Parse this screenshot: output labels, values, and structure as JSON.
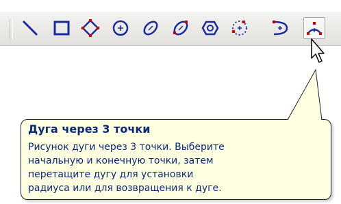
{
  "toolbar": {
    "tools": [
      {
        "icon": "line-icon"
      },
      {
        "icon": "rectangle-icon"
      },
      {
        "icon": "polygon-icon"
      },
      {
        "icon": "circle-center-icon"
      },
      {
        "icon": "ellipse-icon"
      },
      {
        "icon": "ellipse-rotated-icon"
      },
      {
        "icon": "circle-hexagon-icon"
      },
      {
        "icon": "circle-three-point-icon"
      },
      {
        "icon": "arc-icon"
      },
      {
        "icon": "arc-three-point-icon"
      }
    ],
    "active_tool": "arc-three-point-icon"
  },
  "tooltip": {
    "title": "Дуга через 3 точки",
    "body": "Рисунок дуги через 3 точки. Выберите\nначальную и конечную точки, затем\nперетащите дугу для установки\nрадиуса или для возвращения к дуге."
  },
  "colors": {
    "icon_blue": "#1a2a9c",
    "icon_red": "#d40000",
    "tooltip_bg": "#ffffe1",
    "tooltip_text": "#0a2a78"
  }
}
